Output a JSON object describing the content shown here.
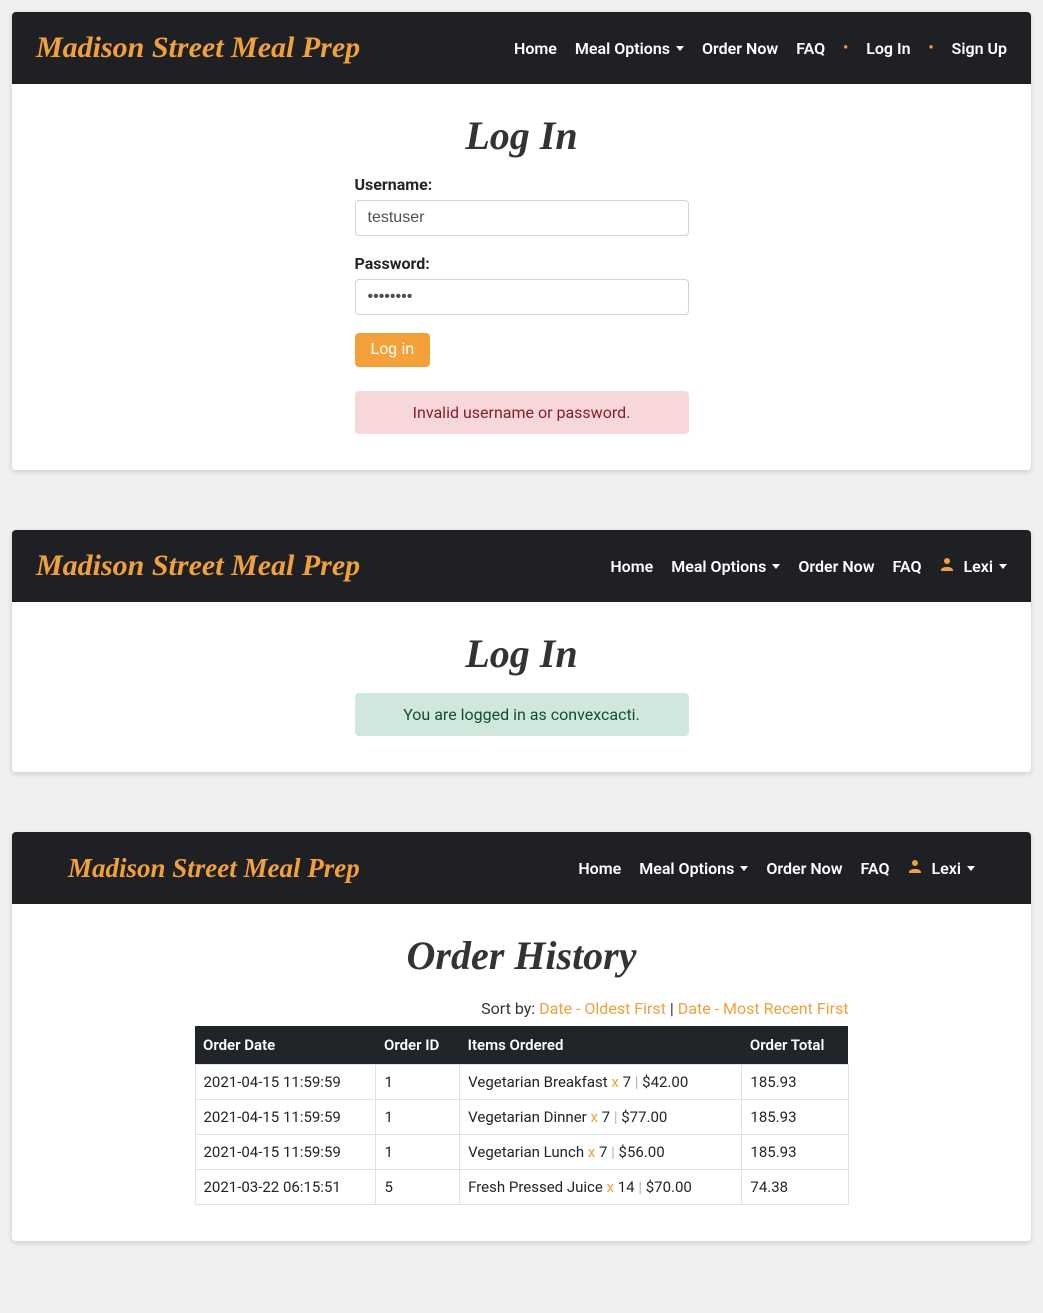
{
  "brand": "Madison Street Meal Prep",
  "panel1": {
    "nav": {
      "home": "Home",
      "meal_options": "Meal Options",
      "order_now": "Order Now",
      "faq": "FAQ",
      "log_in": "Log In",
      "sign_up": "Sign Up"
    },
    "title": "Log In",
    "form": {
      "username_label": "Username:",
      "username_value": "testuser",
      "password_label": "Password:",
      "password_value": "••••••••",
      "submit": "Log in"
    },
    "alert": "Invalid username or password."
  },
  "panel2": {
    "nav": {
      "home": "Home",
      "meal_options": "Meal Options",
      "order_now": "Order Now",
      "faq": "FAQ",
      "user": "Lexi"
    },
    "title": "Log In",
    "alert": "You are logged in as convexcacti."
  },
  "panel3": {
    "nav": {
      "home": "Home",
      "meal_options": "Meal Options",
      "order_now": "Order Now",
      "faq": "FAQ",
      "user": "Lexi"
    },
    "title": "Order History",
    "sort_label": "Sort by: ",
    "sort_oldest": "Date - Oldest First",
    "sort_recent": "Date - Most Recent First",
    "table": {
      "headers": {
        "date": "Order Date",
        "id": "Order ID",
        "items": "Items Ordered",
        "total": "Order Total"
      },
      "rows": [
        {
          "date": "2021-04-15 11:59:59",
          "id": "1",
          "item_name": "Vegetarian Breakfast",
          "qty": "7",
          "price": "$42.00",
          "total": "185.93"
        },
        {
          "date": "2021-04-15 11:59:59",
          "id": "1",
          "item_name": "Vegetarian Dinner",
          "qty": "7",
          "price": "$77.00",
          "total": "185.93"
        },
        {
          "date": "2021-04-15 11:59:59",
          "id": "1",
          "item_name": "Vegetarian Lunch",
          "qty": "7",
          "price": "$56.00",
          "total": "185.93"
        },
        {
          "date": "2021-03-22 06:15:51",
          "id": "5",
          "item_name": "Fresh Pressed Juice",
          "qty": "14",
          "price": "$70.00",
          "total": "74.38"
        }
      ]
    }
  }
}
